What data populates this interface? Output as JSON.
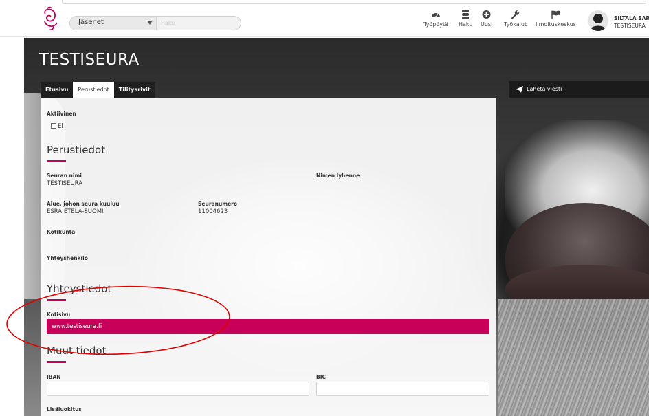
{
  "header": {
    "search_scope": "Jäsenet",
    "search_placeholder": "Haku",
    "nav": [
      {
        "label": "Työpöytä",
        "icon": "dashboard-icon"
      },
      {
        "label": "Haku",
        "icon": "database-icon"
      },
      {
        "label": "Uusi",
        "icon": "plus-circle-icon"
      },
      {
        "label": "Työkalut",
        "icon": "wrench-icon"
      },
      {
        "label": "Ilmoituskeskus",
        "icon": "flag-icon"
      }
    ],
    "user_name": "SILTALA SARI",
    "user_org": "TESTISEURA"
  },
  "page": {
    "title": "TESTISEURA",
    "tabs": [
      "Etusivu",
      "Perustiedot",
      "Tilitysrivit"
    ],
    "active_tab": "Perustiedot",
    "send_message": "Lähetä viesti"
  },
  "form": {
    "active_label": "Aktiivinen",
    "active_value": "Ei",
    "basic_section": "Perustiedot",
    "club_name_label": "Seuran nimi",
    "club_name": "TESTISEURA",
    "abbreviation_label": "Nimen lyhenne",
    "region_label": "Alue, johon seura kuuluu",
    "region": "ESRA ETELÄ-SUOMI",
    "club_number_label": "Seuranumero",
    "club_number": "11004623",
    "municipality_label": "Kotikunta",
    "contact_person_label": "Yhteyshenkilö",
    "contact_section": "Yhteystiedot",
    "homepage_label": "Kotisivu",
    "homepage_value": "www.testiseura.fi",
    "other_section": "Muut tiedot",
    "iban_label": "IBAN",
    "bic_label": "BIC",
    "extra_class_label": "Lisäluokitus"
  },
  "colors": {
    "accent": "#c8005a",
    "annotation": "#e00000"
  }
}
